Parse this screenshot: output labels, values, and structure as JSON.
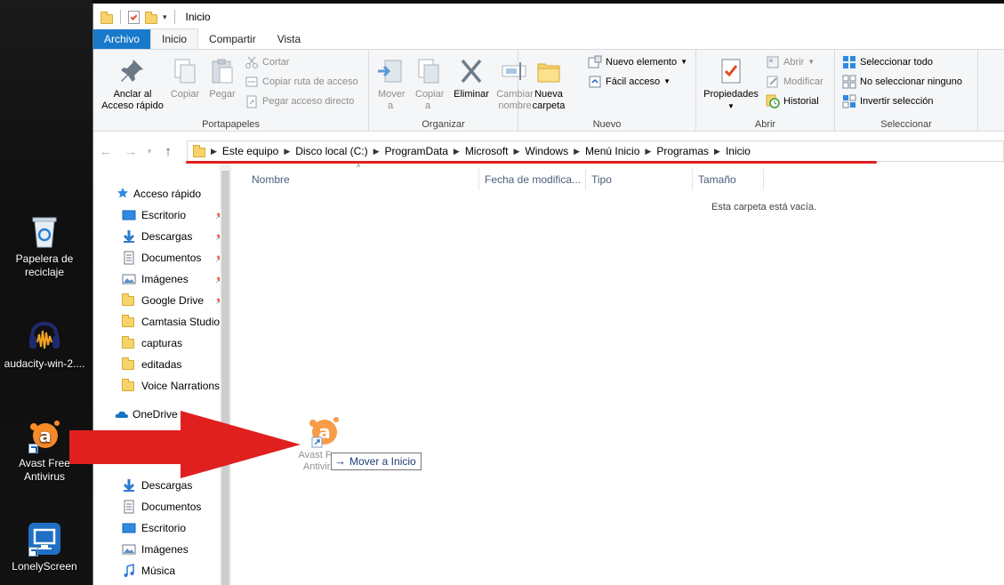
{
  "desktop": {
    "icons": [
      {
        "name": "recycle-bin",
        "label": "Papelera de reciclaje"
      },
      {
        "name": "audacity",
        "label": "audacity-win-2...."
      },
      {
        "name": "avast",
        "label": "Avast Free Antivirus"
      },
      {
        "name": "lonelyscreen",
        "label": "LonelyScreen"
      }
    ]
  },
  "window": {
    "title": "Inicio",
    "tabs": [
      {
        "label": "Archivo"
      },
      {
        "label": "Inicio"
      },
      {
        "label": "Compartir"
      },
      {
        "label": "Vista"
      }
    ]
  },
  "ribbon": {
    "portapapeles": {
      "label": "Portapapeles",
      "anclar": "Anclar al Acceso rápido",
      "copiar": "Copiar",
      "pegar": "Pegar",
      "cortar": "Cortar",
      "copiar_ruta": "Copiar ruta de acceso",
      "pegar_acceso": "Pegar acceso directo"
    },
    "organizar": {
      "label": "Organizar",
      "mover": "Mover a",
      "copiar": "Copiar a",
      "eliminar": "Eliminar",
      "cambiar": "Cambiar nombre"
    },
    "nuevo": {
      "label": "Nuevo",
      "carpeta": "Nueva carpeta",
      "elemento": "Nuevo elemento",
      "facil": "Fácil acceso"
    },
    "abrir": {
      "label": "Abrir",
      "propiedades": "Propiedades",
      "abrir": "Abrir",
      "modificar": "Modificar",
      "historial": "Historial"
    },
    "seleccionar": {
      "label": "Seleccionar",
      "todo": "Seleccionar todo",
      "ninguno": "No seleccionar ninguno",
      "invertir": "Invertir selección"
    }
  },
  "address": {
    "crumbs": [
      "Este equipo",
      "Disco local (C:)",
      "ProgramData",
      "Microsoft",
      "Windows",
      "Menú Inicio",
      "Programas",
      "Inicio"
    ]
  },
  "navpane": {
    "items": [
      {
        "label": "Acceso rápido"
      },
      {
        "label": "Escritorio"
      },
      {
        "label": "Descargas"
      },
      {
        "label": "Documentos"
      },
      {
        "label": "Imágenes"
      },
      {
        "label": "Google Drive"
      },
      {
        "label": "Camtasia Studio"
      },
      {
        "label": "capturas"
      },
      {
        "label": "editadas"
      },
      {
        "label": "Voice Narrations"
      },
      {
        "label": "OneDrive"
      },
      {
        "label": "Descargas"
      },
      {
        "label": "Documentos"
      },
      {
        "label": "Escritorio"
      },
      {
        "label": "Imágenes"
      },
      {
        "label": "Música"
      }
    ]
  },
  "content": {
    "columns": [
      {
        "label": "Nombre"
      },
      {
        "label": "Fecha de modifica..."
      },
      {
        "label": "Tipo"
      },
      {
        "label": "Tamaño"
      }
    ],
    "empty_message": "Esta carpeta está vacía."
  },
  "drag": {
    "icon_label": "Avast Free Antivirus",
    "tooltip": "Mover a Inicio"
  },
  "colors": {
    "file_tab": "#1979ca",
    "annotation_red": "#e0201f",
    "folder": "#f7d36b",
    "avast_orange": "#f68b28"
  }
}
